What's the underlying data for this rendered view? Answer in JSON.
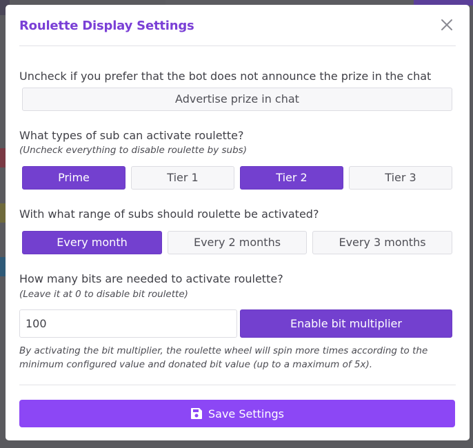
{
  "modal": {
    "title": "Roulette Display Settings",
    "close_icon": "close-icon"
  },
  "announce": {
    "question": "Uncheck if you prefer that the bot does not announce the prize in the chat",
    "toggle_label": "Advertise prize in chat",
    "enabled": false
  },
  "sub_types": {
    "question": "What types of sub can activate roulette?",
    "hint": "(Uncheck everything to disable roulette by subs)",
    "options": [
      {
        "label": "Prime",
        "selected": true
      },
      {
        "label": "Tier 1",
        "selected": false
      },
      {
        "label": "Tier 2",
        "selected": true
      },
      {
        "label": "Tier 3",
        "selected": false
      }
    ]
  },
  "sub_range": {
    "question": "With what range of subs should roulette be activated?",
    "options": [
      {
        "label": "Every month",
        "selected": true
      },
      {
        "label": "Every 2 months",
        "selected": false
      },
      {
        "label": "Every 3 months",
        "selected": false
      }
    ]
  },
  "bits": {
    "question": "How many bits are needed to activate roulette?",
    "hint": "(Leave it at 0 to disable bit roulette)",
    "value": "100",
    "multiplier_label": "Enable bit multiplier",
    "multiplier_note": "By activating the bit multiplier, the roulette wheel will spin more times according to the minimum configured value and donated bit value (up to a maximum of 5x)."
  },
  "footer": {
    "save_label": "Save Settings",
    "save_icon": "floppy-disk-icon"
  },
  "colors": {
    "accent": "#7340cf",
    "save": "#8c47f5",
    "title": "#7a3fd6"
  }
}
